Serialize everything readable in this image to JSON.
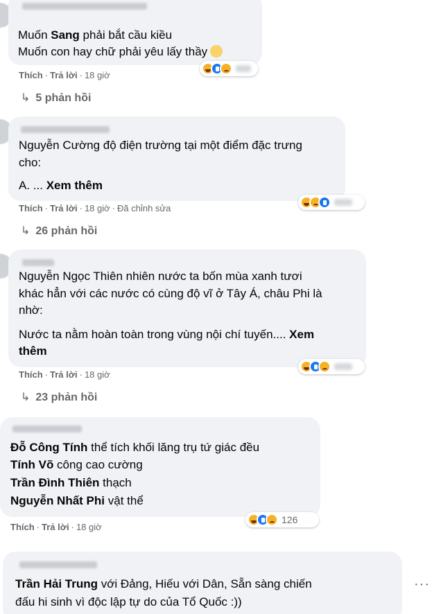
{
  "actions": {
    "like": "Thích",
    "reply": "Trả lời",
    "sep": "·"
  },
  "comments": [
    {
      "lines": [
        [
          {
            "t": "Muốn ",
            "b": false
          },
          {
            "t": "Sang",
            "b": true
          },
          {
            "t": " phải bắt cầu kiều",
            "b": false
          }
        ],
        [
          {
            "t": "Muốn con hay chữ phải yêu lấy thầy",
            "b": false
          }
        ]
      ],
      "time": "18 giờ",
      "edited": "",
      "reaction_count": "",
      "reactions": [
        "haha",
        "like",
        "sad"
      ],
      "replies": "5 phản hồi"
    },
    {
      "lines": [
        [
          {
            "t": "Nguyễn Cường độ điện trường tại một điểm đặc trưng",
            "b": false
          }
        ],
        [
          {
            "t": "cho:",
            "b": false
          }
        ],
        [
          {
            "t": "A. ... ",
            "b": false
          },
          {
            "t": "Xem thêm",
            "b": true
          }
        ]
      ],
      "time": "18 giờ",
      "edited": "Đã chỉnh sửa",
      "reaction_count": "",
      "reactions": [
        "haha",
        "sad",
        "like"
      ],
      "replies": "26 phản hồi"
    },
    {
      "lines": [
        [
          {
            "t": "Nguyễn Ngọc Thiên nhiên nước ta bốn mùa xanh tươi",
            "b": false
          }
        ],
        [
          {
            "t": "khác hẳn với các nước có cùng độ vĩ ở Tây Á, châu Phi là",
            "b": false
          }
        ],
        [
          {
            "t": "nhờ:",
            "b": false
          }
        ],
        [
          {
            "t": "Nước ta nằm hoàn toàn trong vùng nội chí tuyến.... ",
            "b": false
          },
          {
            "t": "Xem",
            "b": true
          }
        ],
        [
          {
            "t": "thêm",
            "b": true
          }
        ]
      ],
      "time": "18 giờ",
      "edited": "",
      "reaction_count": "",
      "reactions": [
        "haha",
        "like",
        "sad"
      ],
      "replies": "23 phản hồi"
    },
    {
      "lines": [
        [
          {
            "t": "Đỗ Công Tính",
            "b": true
          },
          {
            "t": " thể tích khối lăng trụ tứ giác đều",
            "b": false
          }
        ],
        [
          {
            "t": "Tính Võ",
            "b": true
          },
          {
            "t": " công cao cường",
            "b": false
          }
        ],
        [
          {
            "t": "Trần Đình Thiên",
            "b": true
          },
          {
            "t": " thạch",
            "b": false
          }
        ],
        [
          {
            "t": "Nguyễn Nhất Phi",
            "b": true
          },
          {
            "t": " vật thể",
            "b": false
          }
        ]
      ],
      "time": "18 giờ",
      "edited": "",
      "reaction_count": "126",
      "reactions": [
        "haha",
        "like",
        "sad"
      ],
      "replies": ""
    },
    {
      "lines": [
        [
          {
            "t": "Trần Hải Trung",
            "b": true
          },
          {
            "t": " với Đảng, Hiếu với Dân, Sẵn sàng chiến",
            "b": false
          }
        ],
        [
          {
            "t": "đấu hi sinh vì độc lập tự do của Tổ Quốc :))",
            "b": false
          }
        ]
      ],
      "time": "",
      "edited": "",
      "reaction_count": "",
      "reactions": [],
      "replies": ""
    }
  ]
}
